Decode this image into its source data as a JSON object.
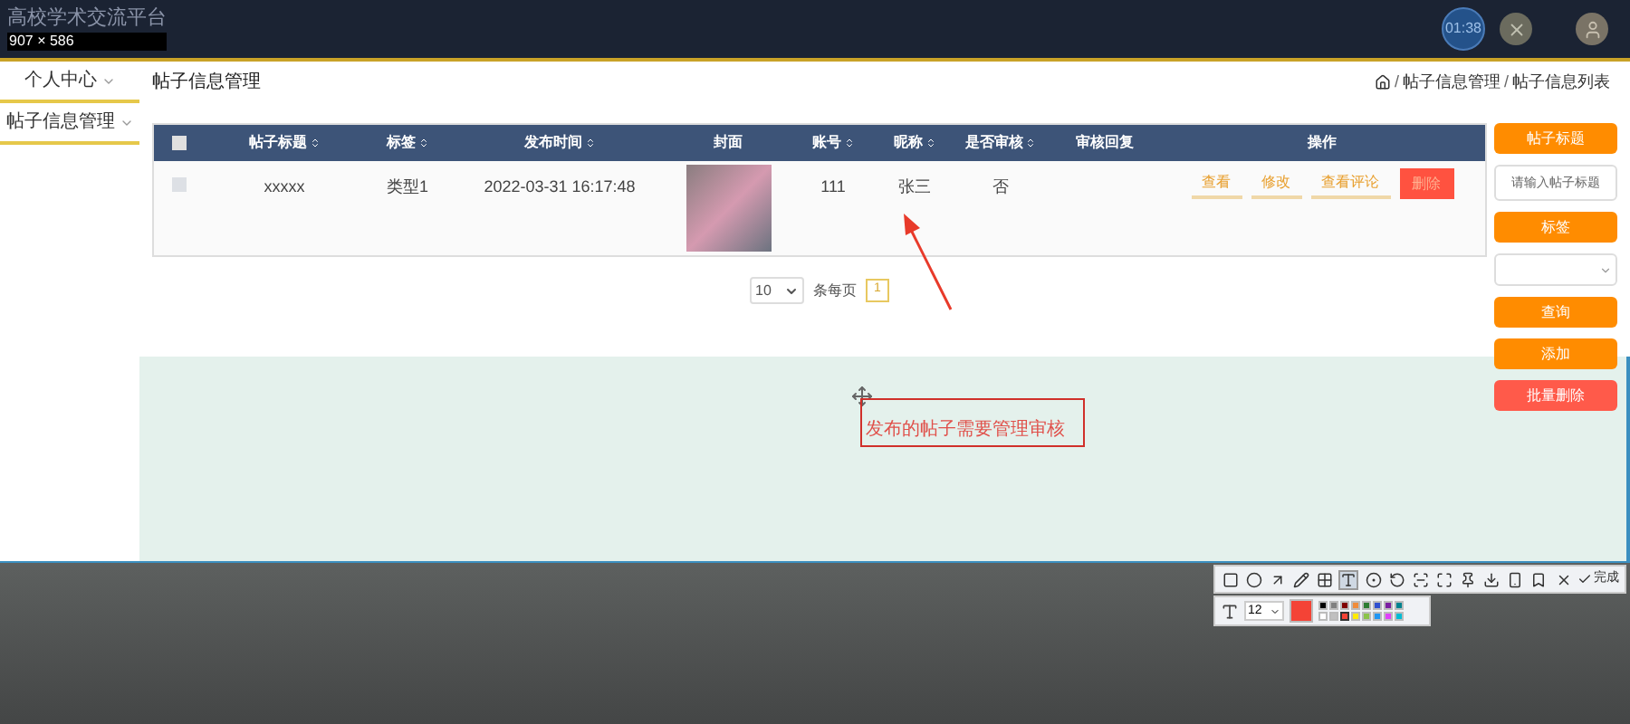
{
  "topbar": {
    "title": "高校学术交流平台",
    "size_label": "907 × 586",
    "timer": "01:38"
  },
  "sidebar": {
    "items": [
      {
        "label": "个人中心"
      },
      {
        "label": "帖子信息管理"
      }
    ]
  },
  "page": {
    "title": "帖子信息管理",
    "breadcrumb": [
      {
        "kind": "separator",
        "text": "/"
      },
      {
        "kind": "link",
        "text": "帖子信息管理"
      },
      {
        "kind": "separator",
        "text": "/"
      },
      {
        "kind": "link",
        "text": "帖子信息列表"
      }
    ]
  },
  "table": {
    "select_all_checked": false,
    "columns": [
      {
        "label": "帖子标题",
        "sortable": true
      },
      {
        "label": "标签",
        "sortable": true
      },
      {
        "label": "发布时间",
        "sortable": true
      },
      {
        "label": "封面",
        "sortable": false
      },
      {
        "label": "账号",
        "sortable": true
      },
      {
        "label": "昵称",
        "sortable": true
      },
      {
        "label": "是否审核",
        "sortable": true
      },
      {
        "label": "审核回复",
        "sortable": false
      },
      {
        "label": "操作",
        "sortable": false
      }
    ],
    "rows": [
      {
        "checked": false,
        "title": "xxxxx",
        "tag": "类型1",
        "time": "2022-03-31 16:17:48",
        "account": "111",
        "nickname": "张三",
        "reviewed": "否",
        "actions": [
          {
            "label": "查看",
            "kind": "link"
          },
          {
            "label": "修改",
            "kind": "link"
          },
          {
            "label": "查看评论",
            "kind": "link"
          },
          {
            "label": "删除",
            "kind": "danger"
          }
        ]
      }
    ]
  },
  "pagination": {
    "page_size": "10",
    "per_page_label": "条每页",
    "pages": [
      {
        "label": "1",
        "selected": true
      }
    ]
  },
  "search_panel": [
    {
      "kind": "label",
      "text": "帖子标题"
    },
    {
      "kind": "input",
      "placeholder": "请输入帖子标题"
    },
    {
      "kind": "label",
      "text": "标签"
    },
    {
      "kind": "select"
    },
    {
      "kind": "button",
      "text": "查询"
    },
    {
      "kind": "button",
      "text": "添加"
    },
    {
      "kind": "danger",
      "text": "批量删除"
    }
  ],
  "annotation": {
    "text": "发布的帖子需要管理审核"
  },
  "capture_toolbar": {
    "tools": [
      {
        "kind": "rectangle",
        "selected": false
      },
      {
        "kind": "ellipse",
        "selected": false
      },
      {
        "kind": "arrow",
        "selected": false
      },
      {
        "kind": "pencil",
        "selected": false
      },
      {
        "kind": "mosaic",
        "selected": false
      },
      {
        "kind": "text",
        "selected": true
      },
      {
        "kind": "number",
        "selected": false
      },
      {
        "kind": "undo",
        "selected": false
      },
      {
        "kind": "scan",
        "selected": false
      },
      {
        "kind": "expand",
        "selected": false
      },
      {
        "kind": "pin",
        "selected": false
      },
      {
        "kind": "download",
        "selected": false
      },
      {
        "kind": "phone",
        "selected": false
      },
      {
        "kind": "bookmark",
        "selected": false
      },
      {
        "kind": "close",
        "selected": false
      }
    ],
    "done": "完成",
    "font_size": "12",
    "palette": [
      {
        "color": "#000000",
        "selected": false
      },
      {
        "color": "#808080",
        "selected": false
      },
      {
        "color": "#800000",
        "selected": false
      },
      {
        "color": "#f08c3a",
        "selected": false
      },
      {
        "color": "#2e7d32",
        "selected": false
      },
      {
        "color": "#3050d0",
        "selected": false
      },
      {
        "color": "#7b1fa2",
        "selected": false
      },
      {
        "color": "#00838f",
        "selected": false
      },
      {
        "color": "#ffffff",
        "selected": false
      },
      {
        "color": "#c0c0c0",
        "selected": false
      },
      {
        "color": "#f44336",
        "selected": true
      },
      {
        "color": "#ffeb00",
        "selected": false
      },
      {
        "color": "#8bc34a",
        "selected": false
      },
      {
        "color": "#2196f3",
        "selected": false
      },
      {
        "color": "#e040fb",
        "selected": false
      },
      {
        "color": "#00bcd4",
        "selected": false
      }
    ]
  }
}
